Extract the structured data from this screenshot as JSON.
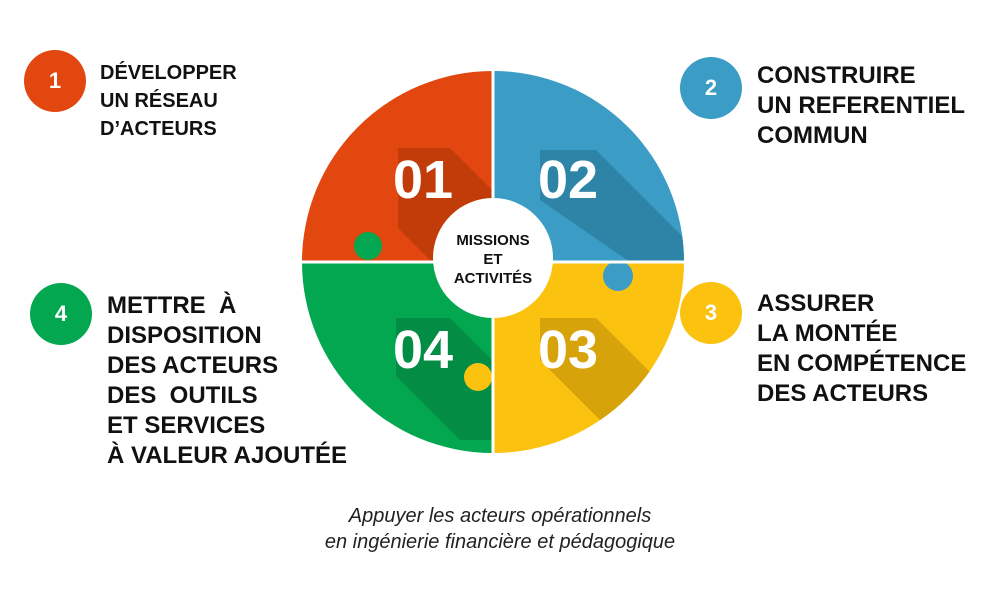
{
  "center": {
    "lines": [
      "MISSIONS",
      "ET",
      "ACTIVITÉS"
    ]
  },
  "quadrants": [
    {
      "number": "01",
      "color": "#E2470F",
      "dark": "#A73306"
    },
    {
      "number": "02",
      "color": "#3B9DC5",
      "dark": "#226F8E"
    },
    {
      "number": "03",
      "color": "#FCC210",
      "dark": "#B68A06"
    },
    {
      "number": "04",
      "color": "#03A750",
      "dark": "#03773A"
    }
  ],
  "items": [
    {
      "badge": "1",
      "color": "#E2470F",
      "lines": [
        "DÉVELOPPER",
        "UN RÉSEAU",
        "D’ACTEURS"
      ]
    },
    {
      "badge": "2",
      "color": "#3B9DC5",
      "lines": [
        "CONSTRUIRE",
        "UN REFERENTIEL",
        "COMMUN"
      ]
    },
    {
      "badge": "3",
      "color": "#FCC210",
      "lines": [
        "ASSURER",
        "LA MONTÉE",
        "EN COMPÉTENCE",
        "DES ACTEURS"
      ]
    },
    {
      "badge": "4",
      "color": "#03A750",
      "lines": [
        "METTRE  À",
        "DISPOSITION",
        "DES ACTEURS",
        "DES  OUTILS",
        "ET SERVICES",
        "À VALEUR AJOUTÉE"
      ]
    }
  ],
  "caption": {
    "line1": "Appuyer les acteurs opérationnels",
    "line2": "en ingénierie financière et pédagogique"
  }
}
